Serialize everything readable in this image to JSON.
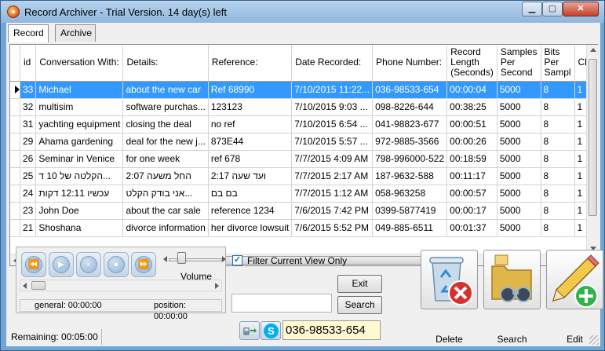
{
  "window": {
    "title": "Record Archiver - Trial Version. 14 day(s) left",
    "minimize": "▁",
    "maximize": "▢",
    "close": "✕"
  },
  "tabs": [
    {
      "label": "Record"
    },
    {
      "label": "Archive"
    }
  ],
  "grid": {
    "columns": [
      {
        "label": "id"
      },
      {
        "label": "Conversation With:"
      },
      {
        "label": "Details:"
      },
      {
        "label": "Reference:"
      },
      {
        "label": "Date Recorded:"
      },
      {
        "label": "Phone Number:"
      },
      {
        "label": "Record Length (Seconds)"
      },
      {
        "label": "Samples Per Second"
      },
      {
        "label": "Bits Per Sampl"
      },
      {
        "label": "Ch"
      }
    ],
    "selected_index": 0,
    "rows": [
      {
        "id": "33",
        "with": "Michael",
        "details": "about the new car",
        "ref": "Ref 68990",
        "date": "7/10/2015 11:22...",
        "phone": "036-98533-654",
        "length": "00:00:04",
        "sps": "5000",
        "bits": "8",
        "ch": "1"
      },
      {
        "id": "32",
        "with": "multisim",
        "details": "software purchas...",
        "ref": "123123",
        "date": "7/10/2015 9:03 ...",
        "phone": "098-8226-644",
        "length": "00:38:25",
        "sps": "5000",
        "bits": "8",
        "ch": "1"
      },
      {
        "id": "31",
        "with": "yachting equipment",
        "details": "closing the deal",
        "ref": "no ref",
        "date": "7/10/2015 6:54 ...",
        "phone": "041-98823-677",
        "length": "00:00:51",
        "sps": "5000",
        "bits": "8",
        "ch": "1"
      },
      {
        "id": "29",
        "with": "Ahama gardening",
        "details": "deal for the new j...",
        "ref": "873E44",
        "date": "7/10/2015 5:57 ...",
        "phone": "972-9885-3566",
        "length": "00:00:26",
        "sps": "5000",
        "bits": "8",
        "ch": "1"
      },
      {
        "id": "26",
        "with": "Seminar in Venice",
        "details": "for one week",
        "ref": "ref 678",
        "date": "7/7/2015 4:09 AM",
        "phone": "798-996000-522",
        "length": "00:18:59",
        "sps": "5000",
        "bits": "8",
        "ch": "1"
      },
      {
        "id": "25",
        "with": "הקלטה של 10 ד...",
        "details": "החל משעה 2:07",
        "ref": "ועד שעה 2:17",
        "date": "7/7/2015 2:17 AM",
        "phone": "187-9632-588",
        "length": "00:11:17",
        "sps": "5000",
        "bits": "8",
        "ch": "1"
      },
      {
        "id": "24",
        "with": "עכשיו 12:11 דקות",
        "details": "אני בודק הקלט...",
        "ref": "בם בם",
        "date": "7/7/2015 1:12 AM",
        "phone": "058-963258",
        "length": "00:00:57",
        "sps": "5000",
        "bits": "8",
        "ch": "1"
      },
      {
        "id": "23",
        "with": "John Doe",
        "details": "about the car sale",
        "ref": "reference 1234",
        "date": "7/6/2015 7:42 PM",
        "phone": "0399-5877419",
        "length": "00:00:17",
        "sps": "5000",
        "bits": "8",
        "ch": "1"
      },
      {
        "id": "21",
        "with": "Shoshana",
        "details": "divorce information",
        "ref": "her divorce lowsuit",
        "date": "7/6/2015 5:52 PM",
        "phone": "049-885-6511",
        "length": "00:01:37",
        "sps": "5000",
        "bits": "8",
        "ch": "1"
      }
    ]
  },
  "player": {
    "volume_label": "Volume",
    "volume_level": 0.2,
    "general_label": "general: 00:00:00",
    "position_label": "position: 00:00:00"
  },
  "filter": {
    "checkbox_label": "Filter Current View Only",
    "checked": true,
    "check_glyph": "✓"
  },
  "buttons": {
    "exit": "Exit",
    "search": "Search",
    "delete": "Delete",
    "search_big": "Search",
    "edit": "Edit"
  },
  "search_input": {
    "value": ""
  },
  "phone": {
    "value": "036-98533-654"
  },
  "skype_glyph": "S",
  "status": {
    "remaining": "Remaining:  00:05:00"
  },
  "icons": {
    "rewind": "⏪",
    "play": "▶",
    "pause": "⏸",
    "stop": "⏹",
    "forward": "⏩"
  }
}
